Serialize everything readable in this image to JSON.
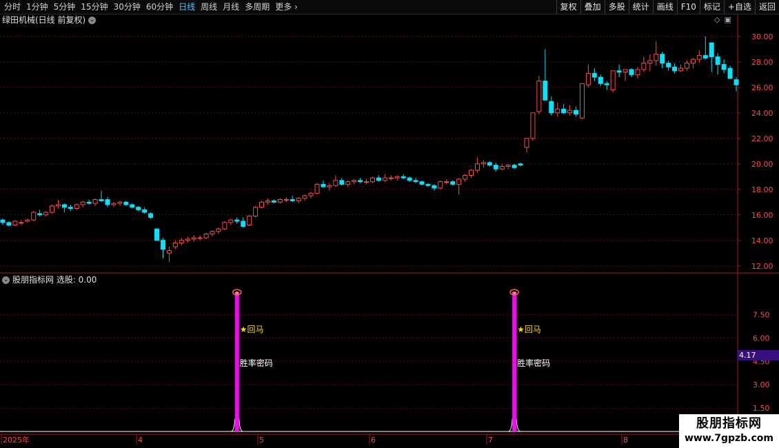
{
  "toolbar": {
    "tabs": [
      "分时",
      "1分钟",
      "5分钟",
      "15分钟",
      "30分钟",
      "60分钟",
      "日线",
      "周线",
      "月线",
      "多周期",
      "更多"
    ],
    "active_tab": 6,
    "more_arrow": "›",
    "right_buttons": [
      "复权",
      "叠加",
      "多股",
      "统计",
      "画线",
      "F10",
      "标记",
      "+自选",
      "返回"
    ]
  },
  "main_chart": {
    "title": "绿田机械(日线 前复权)",
    "y_ticks": [
      "30.00",
      "28.00",
      "26.00",
      "24.00",
      "22.00",
      "20.00",
      "18.00",
      "16.00",
      "14.00",
      "12.00"
    ],
    "icons": [
      "diamond-icon",
      "window-icon"
    ]
  },
  "indicator": {
    "title": "股朋指标网 选股: 0.00",
    "y_ticks": [
      "7.50",
      "6.00",
      "4.50",
      "3.00",
      "1.50"
    ],
    "current_value": "4.17",
    "signal_label_1": "★回马",
    "signal_label_2": "胜率密码"
  },
  "x_axis": {
    "labels": [
      "2025年",
      "4",
      "5",
      "6",
      "7",
      "8"
    ]
  },
  "watermark": {
    "line1": "股朋指标网",
    "line2": "www.7gpzb.com"
  },
  "chart_data": {
    "type": "candlestick",
    "ylim": [
      11.5,
      30.8
    ],
    "up_color": "#ff4a4a",
    "down_color": "#00e5ff",
    "signal_color": "#ff00ff",
    "candles": [
      [
        15.6,
        15.7,
        15.2,
        15.4
      ],
      [
        15.4,
        15.5,
        15.1,
        15.2
      ],
      [
        15.2,
        15.6,
        15.1,
        15.5
      ],
      [
        15.4,
        15.6,
        15.2,
        15.4
      ],
      [
        15.5,
        15.7,
        15.4,
        15.6
      ],
      [
        15.6,
        16.3,
        15.5,
        16.2
      ],
      [
        16.1,
        16.4,
        15.9,
        16.0
      ],
      [
        16.0,
        16.3,
        15.9,
        16.2
      ],
      [
        16.2,
        16.8,
        16.1,
        16.7
      ],
      [
        16.7,
        17.2,
        16.5,
        16.8
      ],
      [
        16.8,
        16.9,
        16.2,
        16.6
      ],
      [
        16.6,
        16.8,
        16.3,
        16.5
      ],
      [
        16.5,
        16.9,
        16.4,
        16.8
      ],
      [
        16.8,
        17.1,
        16.6,
        17.0
      ],
      [
        17.0,
        17.2,
        16.8,
        16.9
      ],
      [
        16.9,
        17.3,
        16.7,
        17.2
      ],
      [
        17.2,
        17.9,
        17.0,
        17.1
      ],
      [
        17.2,
        17.4,
        16.6,
        16.8
      ],
      [
        16.8,
        17.0,
        16.6,
        16.9
      ],
      [
        16.9,
        17.1,
        16.7,
        17.0
      ],
      [
        17.0,
        17.1,
        16.7,
        16.8
      ],
      [
        16.8,
        16.9,
        16.5,
        16.6
      ],
      [
        16.6,
        16.7,
        16.3,
        16.4
      ],
      [
        16.4,
        16.6,
        16.1,
        16.2
      ],
      [
        16.1,
        16.2,
        15.7,
        15.8
      ],
      [
        14.9,
        14.9,
        14.1,
        14.0
      ],
      [
        14.0,
        14.2,
        12.6,
        13.3
      ],
      [
        13.0,
        13.5,
        12.3,
        13.2
      ],
      [
        13.5,
        14.0,
        13.3,
        13.8
      ],
      [
        13.8,
        14.2,
        13.6,
        14.0
      ],
      [
        14.0,
        14.3,
        13.8,
        14.1
      ],
      [
        14.1,
        14.4,
        13.9,
        14.2
      ],
      [
        14.2,
        14.4,
        14.0,
        14.2
      ],
      [
        14.2,
        14.6,
        14.1,
        14.5
      ],
      [
        14.5,
        14.8,
        14.3,
        14.7
      ],
      [
        14.7,
        15.0,
        14.5,
        14.9
      ],
      [
        14.9,
        15.5,
        14.8,
        15.4
      ],
      [
        15.4,
        15.7,
        15.2,
        15.6
      ],
      [
        15.6,
        15.8,
        15.3,
        15.5
      ],
      [
        15.5,
        15.8,
        15.0,
        15.1
      ],
      [
        15.2,
        16.0,
        15.1,
        15.9
      ],
      [
        15.9,
        16.7,
        15.8,
        16.6
      ],
      [
        16.6,
        17.1,
        16.5,
        17.0
      ],
      [
        17.0,
        17.3,
        16.8,
        17.1
      ],
      [
        17.1,
        17.2,
        16.9,
        17.0
      ],
      [
        17.0,
        17.3,
        16.9,
        17.2
      ],
      [
        17.2,
        17.4,
        17.0,
        17.2
      ],
      [
        17.2,
        17.5,
        17.0,
        17.1
      ],
      [
        17.1,
        17.4,
        16.9,
        17.3
      ],
      [
        17.3,
        17.6,
        17.1,
        17.5
      ],
      [
        17.5,
        17.8,
        17.3,
        17.7
      ],
      [
        17.7,
        18.5,
        17.6,
        18.4
      ],
      [
        18.4,
        18.7,
        18.1,
        18.2
      ],
      [
        18.2,
        18.5,
        17.9,
        18.3
      ],
      [
        18.3,
        19.1,
        18.2,
        18.7
      ],
      [
        18.7,
        18.9,
        18.3,
        18.4
      ],
      [
        18.4,
        18.7,
        18.2,
        18.6
      ],
      [
        18.6,
        18.8,
        18.4,
        18.7
      ],
      [
        18.7,
        18.9,
        18.5,
        18.6
      ],
      [
        18.6,
        18.8,
        18.4,
        18.6
      ],
      [
        18.6,
        19.0,
        18.5,
        18.9
      ],
      [
        18.9,
        19.1,
        18.6,
        18.7
      ],
      [
        18.7,
        19.2,
        18.6,
        18.9
      ],
      [
        18.9,
        19.1,
        18.7,
        18.9
      ],
      [
        18.9,
        19.1,
        18.7,
        19.0
      ],
      [
        19.0,
        19.2,
        18.8,
        18.9
      ],
      [
        18.9,
        19.0,
        18.6,
        18.7
      ],
      [
        18.7,
        18.9,
        18.5,
        18.6
      ],
      [
        18.6,
        18.7,
        18.3,
        18.4
      ],
      [
        18.4,
        18.5,
        18.2,
        18.3
      ],
      [
        18.3,
        18.4,
        17.9,
        18.1
      ],
      [
        18.1,
        18.7,
        18.0,
        18.6
      ],
      [
        18.6,
        18.8,
        18.4,
        18.6
      ],
      [
        18.6,
        18.7,
        18.3,
        18.4
      ],
      [
        18.4,
        18.9,
        17.6,
        18.8
      ],
      [
        18.8,
        19.2,
        18.6,
        19.1
      ],
      [
        19.1,
        19.6,
        18.9,
        19.5
      ],
      [
        19.5,
        20.5,
        19.3,
        20.0
      ],
      [
        20.0,
        20.3,
        19.7,
        20.1
      ],
      [
        20.1,
        20.2,
        19.8,
        19.9
      ],
      [
        19.9,
        20.1,
        19.4,
        19.6
      ],
      [
        19.6,
        20.0,
        19.5,
        19.8
      ],
      [
        19.8,
        20.0,
        19.6,
        19.9
      ],
      [
        19.9,
        20.0,
        19.6,
        19.7
      ],
      [
        20.0,
        20.1,
        19.8,
        19.9
      ],
      [
        21.3,
        22.0,
        20.9,
        22.0
      ],
      [
        22.0,
        24.0,
        21.8,
        24.0
      ],
      [
        24.1,
        26.9,
        23.9,
        26.5
      ],
      [
        26.5,
        29.0,
        26.3,
        25.0
      ],
      [
        24.9,
        25.3,
        23.8,
        24.0
      ],
      [
        24.0,
        24.8,
        23.7,
        24.3
      ],
      [
        24.3,
        24.7,
        23.9,
        24.0
      ],
      [
        24.0,
        24.6,
        23.8,
        24.2
      ],
      [
        24.2,
        24.5,
        23.7,
        23.9
      ],
      [
        23.6,
        24.7,
        23.5,
        26.3
      ],
      [
        26.2,
        27.8,
        26.0,
        27.1
      ],
      [
        27.1,
        27.5,
        26.5,
        26.8
      ],
      [
        26.8,
        27.0,
        26.1,
        26.3
      ],
      [
        26.3,
        26.5,
        25.8,
        26.2
      ],
      [
        25.8,
        26.8,
        25.6,
        27.3
      ],
      [
        27.3,
        27.8,
        26.8,
        27.2
      ],
      [
        27.2,
        27.4,
        26.5,
        27.4
      ],
      [
        27.4,
        27.5,
        26.8,
        27.0
      ],
      [
        27.0,
        27.6,
        26.7,
        27.4
      ],
      [
        27.4,
        28.4,
        27.2,
        27.9
      ],
      [
        27.9,
        28.6,
        27.3,
        28.1
      ],
      [
        28.1,
        29.6,
        27.7,
        28.6
      ],
      [
        28.6,
        28.8,
        27.5,
        27.9
      ],
      [
        27.9,
        28.1,
        27.3,
        27.6
      ],
      [
        27.6,
        27.9,
        27.1,
        27.3
      ],
      [
        27.3,
        27.8,
        27.2,
        27.5
      ],
      [
        27.5,
        28.1,
        27.3,
        27.9
      ],
      [
        27.9,
        28.3,
        27.5,
        28.2
      ],
      [
        28.2,
        28.9,
        27.9,
        28.5
      ],
      [
        28.5,
        30.0,
        28.2,
        28.3
      ],
      [
        29.5,
        29.5,
        27.2,
        28.4
      ],
      [
        28.4,
        28.7,
        27.0,
        27.8
      ],
      [
        27.8,
        28.2,
        27.1,
        27.4
      ],
      [
        27.5,
        27.7,
        26.7,
        26.7
      ],
      [
        26.6,
        26.8,
        25.7,
        26.2
      ]
    ],
    "signal_indices": [
      38,
      83
    ]
  }
}
